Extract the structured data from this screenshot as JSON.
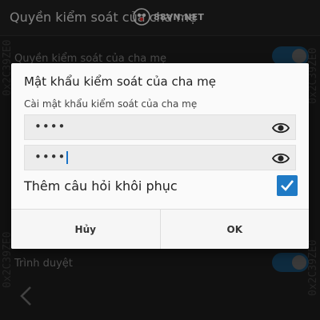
{
  "background": {
    "title": "Quyền kiểm soát của cha mẹ",
    "row1_label": "Quyền kiểm soát của cha mẹ",
    "row2_label": "Trình duyệt",
    "watermark_text": "88VN.NET",
    "side_marks": [
      "0x2C39ZE0",
      "0x2C39ZE0",
      "0x2C39ZE0",
      "0x2C39ZE0"
    ]
  },
  "dialog": {
    "title": "Mật khẩu kiểm soát của cha mẹ",
    "subtitle": "Cài mật khẩu kiểm soát của cha mẹ",
    "password_field_1": {
      "value": "••••",
      "eye_icon": "eye-icon"
    },
    "password_field_2": {
      "value": "••••",
      "eye_icon": "eye-icon"
    },
    "recovery_label": "Thêm câu hỏi khôi phục",
    "recovery_checked": true,
    "cancel_label": "Hủy",
    "ok_label": "OK"
  },
  "colors": {
    "accent": "#1f7ac5",
    "toggle": "#1a4f73",
    "dialog_bg": "#fafafa",
    "screen_bg": "#1f1f1f"
  }
}
